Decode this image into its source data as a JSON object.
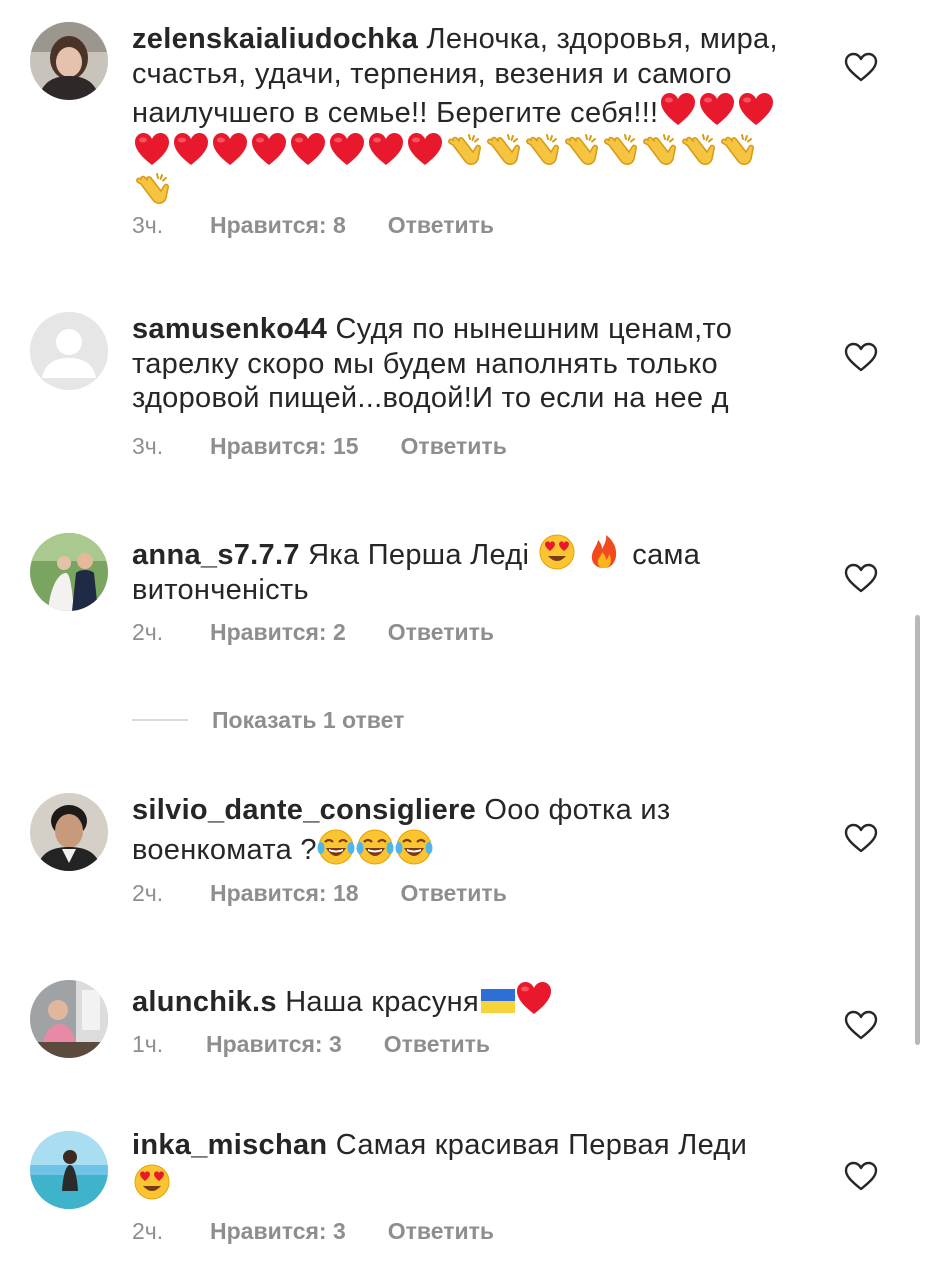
{
  "comments": [
    {
      "username": "zelenskaialiudochka",
      "text": "Леночка, здоровья, мира, счастья, удачи, терпения, везения и самого наилучшего в семье!! Берегите себя!!!",
      "emoji": [
        "heart",
        "heart",
        "heart",
        "heart",
        "heart",
        "heart",
        "heart",
        "heart",
        "heart",
        "heart",
        "heart",
        "clap",
        "clap",
        "clap",
        "clap",
        "clap",
        "clap",
        "clap",
        "clap",
        "clap"
      ],
      "time": "3ч.",
      "likes": "Нравится: 8",
      "reply": "Ответить"
    },
    {
      "username": "samusenko44",
      "text": "Судя по нынешним ценам,то тарелку скоро мы будем наполнять только здоровой пищей...водой!И то если на нее д",
      "time": "3ч.",
      "likes": "Нравится: 15",
      "reply": "Ответить"
    },
    {
      "username": "anna_s7.7.7",
      "text": "Яка Перша Леді",
      "text_after": "сама витонченість",
      "emoji": [
        "heart-eyes",
        "fire"
      ],
      "time": "2ч.",
      "likes": "Нравится: 2",
      "reply": "Ответить",
      "show_replies": "Показать 1 ответ"
    },
    {
      "username": "silvio_dante_consigliere",
      "text": "Ооо фотка из военкомата ?",
      "emoji": [
        "laugh",
        "laugh",
        "laugh"
      ],
      "time": "2ч.",
      "likes": "Нравится: 18",
      "reply": "Ответить"
    },
    {
      "username": "alunchik.s",
      "text": "Наша красуня",
      "emoji": [
        "flag-ua",
        "heart"
      ],
      "time": "1ч.",
      "likes": "Нравится: 3",
      "reply": "Ответить"
    },
    {
      "username": "inka_mischan",
      "text": "Самая красивая Первая Леди",
      "emoji": [
        "heart-eyes"
      ],
      "time": "2ч.",
      "likes": "Нравится: 3",
      "reply": "Ответить"
    }
  ],
  "colors": {
    "text": "#262626",
    "meta": "#8e8e8e",
    "heart": "#e8192c",
    "divider": "#dbdbdb"
  },
  "icons": {
    "like": "heart-outline-icon"
  }
}
